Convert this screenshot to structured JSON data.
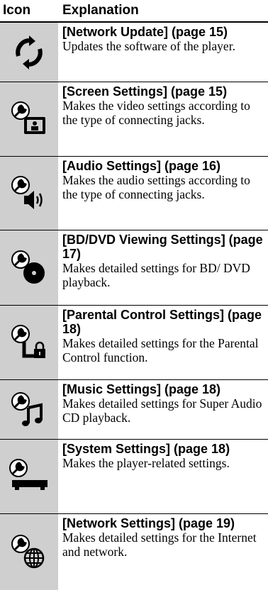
{
  "table": {
    "header": {
      "icon_label": "Icon",
      "explanation_label": "Explanation"
    },
    "rows": [
      {
        "icon": "network-update-icon",
        "title": "[Network Update] (page 15)",
        "description": "Updates the software of the player."
      },
      {
        "icon": "screen-settings-icon",
        "title": "[Screen Settings] (page 15)",
        "description": "Makes the video settings according to the type of connecting jacks."
      },
      {
        "icon": "audio-settings-icon",
        "title": "[Audio Settings] (page 16)",
        "description": "Makes the audio settings according to the type of connecting jacks."
      },
      {
        "icon": "bd-dvd-viewing-settings-icon",
        "title": "[BD/DVD Viewing Settings] (page 17)",
        "description": "Makes detailed settings for BD/ DVD playback."
      },
      {
        "icon": "parental-control-settings-icon",
        "title": "[Parental Control Settings] (page 18)",
        "description": "Makes detailed settings for the Parental Control function."
      },
      {
        "icon": "music-settings-icon",
        "title": "[Music Settings] (page 18)",
        "description": "Makes detailed settings for Super Audio CD playback."
      },
      {
        "icon": "system-settings-icon",
        "title": "[System Settings] (page 18)",
        "description": "Makes the player-related settings."
      },
      {
        "icon": "network-settings-icon",
        "title": "[Network Settings] (page 19)",
        "description": "Makes detailed settings for the Internet and network."
      }
    ]
  }
}
